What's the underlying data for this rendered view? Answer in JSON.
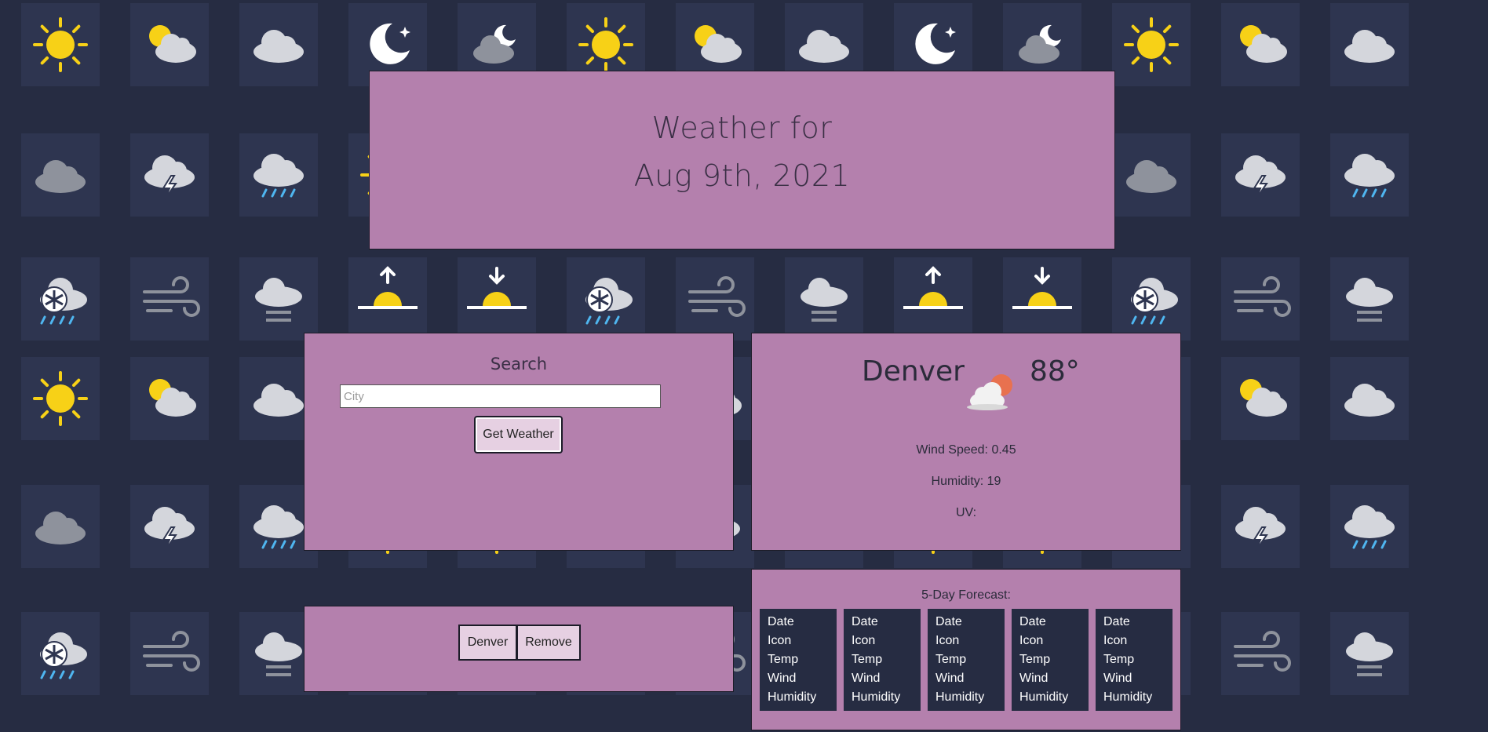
{
  "header": {
    "line1": "Weather for",
    "line2": "Aug 9th, 2021"
  },
  "search": {
    "title": "Search",
    "placeholder": "City",
    "button_label": "Get Weather"
  },
  "history": {
    "items": [
      "Denver"
    ],
    "remove_label": "Remove"
  },
  "current": {
    "city": "Denver",
    "icon": "partly-cloudy-icon",
    "temp": "88°",
    "wind": "Wind Speed: 0.45",
    "humidity": "Humidity: 19",
    "uv": "UV:"
  },
  "forecast": {
    "title": "5-Day Forecast:",
    "days": [
      {
        "date": "Date",
        "icon": "Icon",
        "temp": "Temp",
        "wind": "Wind",
        "humidity": "Humidity"
      },
      {
        "date": "Date",
        "icon": "Icon",
        "temp": "Temp",
        "wind": "Wind",
        "humidity": "Humidity"
      },
      {
        "date": "Date",
        "icon": "Icon",
        "temp": "Temp",
        "wind": "Wind",
        "humidity": "Humidity"
      },
      {
        "date": "Date",
        "icon": "Icon",
        "temp": "Temp",
        "wind": "Wind",
        "humidity": "Humidity"
      },
      {
        "date": "Date",
        "icon": "Icon",
        "temp": "Temp",
        "wind": "Wind",
        "humidity": "Humidity"
      }
    ]
  },
  "background_icons": [
    "sun-icon",
    "partly-sunny-icon",
    "cloud-icon",
    "moon-stars-icon",
    "night-cloudy-icon",
    "sun-icon",
    "partly-sunny-icon",
    "cloud-icon",
    "moon-stars-icon",
    "night-cloudy-icon",
    "sun-icon",
    "partly-sunny-icon",
    "cloud-icon"
  ],
  "colors": {
    "background": "#262c42",
    "panel": "#b480ad",
    "button": "#e6d0e2",
    "card": "#262c42"
  }
}
